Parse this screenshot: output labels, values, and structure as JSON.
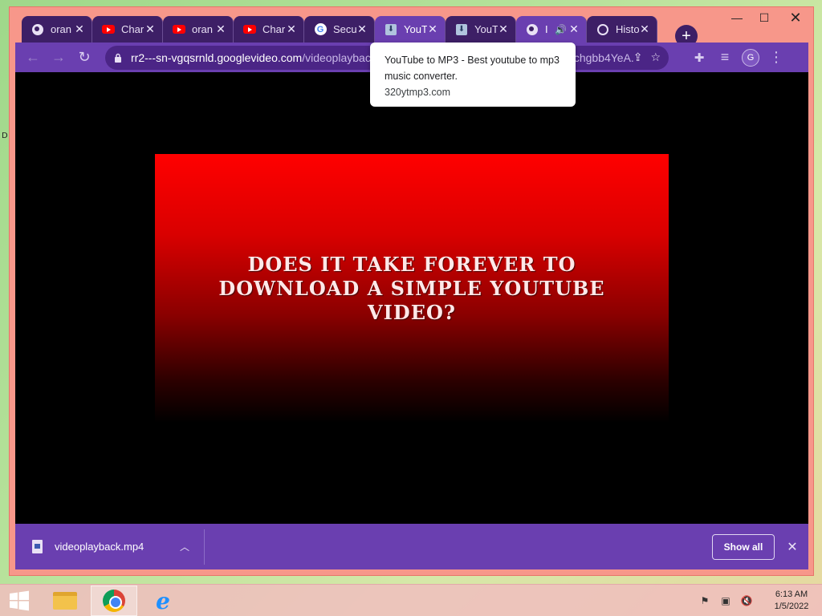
{
  "window_controls": {
    "minimize": "—",
    "maximize": "☐",
    "close": "✕"
  },
  "tabs": [
    {
      "title": "oran",
      "icon": "globe-icon",
      "active": false
    },
    {
      "title": "Char",
      "icon": "youtube-icon",
      "active": false
    },
    {
      "title": "oran",
      "icon": "youtube-icon",
      "active": false
    },
    {
      "title": "Char",
      "icon": "youtube-icon",
      "active": false
    },
    {
      "title": "Secu",
      "icon": "google-icon",
      "active": false
    },
    {
      "title": "YouT",
      "icon": "download-icon",
      "active": true
    },
    {
      "title": "YouT",
      "icon": "download-icon",
      "active": false
    },
    {
      "title": "I",
      "icon": "globe-icon",
      "active": false,
      "audio": true
    },
    {
      "title": "Histo",
      "icon": "history-icon",
      "active": false
    }
  ],
  "tab_close_glyph": "✕",
  "toolbar": {
    "back": "←",
    "forward": "→",
    "reload": "↻",
    "url_main": "rr2---sn-vgqsrnld.googlevideo.com",
    "url_path": "/videoplayback",
    "url_tail": "chgbb4YeA...",
    "share": "⇪",
    "star": "☆",
    "extensions": "✚",
    "media": "≡",
    "profile_initial": "G",
    "menu": "⋮"
  },
  "tooltip": {
    "title": "YouTube to MP3 - Best youtube to mp3 music converter.",
    "host": "320ytmp3.com"
  },
  "video": {
    "text": "Does it take forever to download a simple YouTube video?"
  },
  "download_bar": {
    "file_name": "videoplayback.mp4",
    "chevron": "︿",
    "show_all": "Show all",
    "close": "✕"
  },
  "desktop_mark": "D",
  "taskbar": {
    "time": "6:13 AM",
    "date": "1/5/2022"
  },
  "colors": {
    "accent": "#6a3fb0",
    "tab_inactive": "#3d1f66",
    "frame": "#f7978a",
    "video_red": "#ff0000"
  }
}
